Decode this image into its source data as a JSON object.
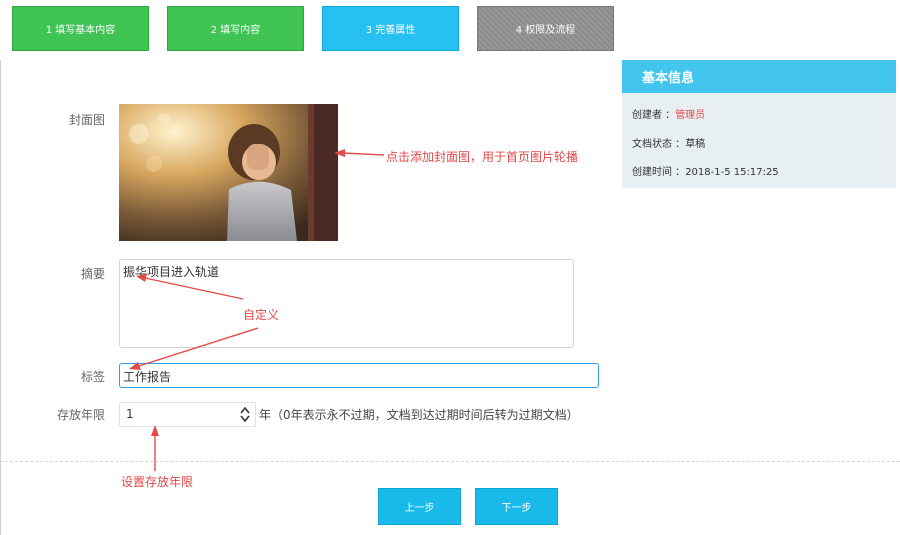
{
  "steps": [
    {
      "label": "1 填写基本内容",
      "color": "#3fc453"
    },
    {
      "label": "2 填写内容",
      "color": "#3fc453"
    },
    {
      "label": "3 完善属性",
      "color": "#26c1f2"
    },
    {
      "label": "4 权限及流程",
      "color": "#8f8f8f"
    }
  ],
  "form": {
    "cover_label": "封面图",
    "summary_label": "摘要",
    "summary_value": "振华项目进入轨道",
    "tag_label": "标签",
    "tag_value": "工作报告",
    "retention_label": "存放年限",
    "retention_value": "1",
    "retention_note": "年（0年表示永不过期，文档到达过期时间后转为过期文档）"
  },
  "annotations": {
    "cover": "点击添加封面图，用于首页图片轮播",
    "custom": "自定义",
    "retention": "设置存放年限"
  },
  "buttons": {
    "prev": "上一步",
    "next": "下一步"
  },
  "info": {
    "title": "基本信息",
    "creator_label": "创建者 ：",
    "creator_value": "管理员",
    "status_label": "文档状态 ：",
    "status_value": "草稿",
    "created_label": "创建时间 ：",
    "created_value": "2018-1-5 15:17:25"
  },
  "colors": {
    "accent": "#26c1f2",
    "done": "#3fc453",
    "pending": "#8f8f8f",
    "annotation": "#e24a4a",
    "button": "#19b9ea"
  }
}
